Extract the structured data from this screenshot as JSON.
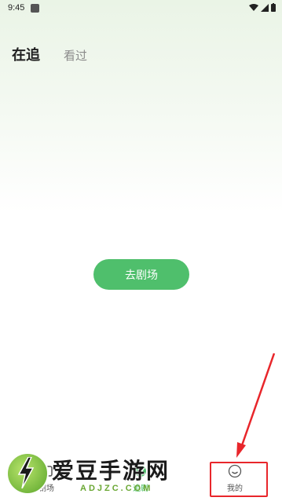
{
  "status_bar": {
    "time": "9:45"
  },
  "header": {
    "tabs": [
      {
        "label": "在追"
      },
      {
        "label": "看过"
      }
    ]
  },
  "main": {
    "go_button_label": "去剧场"
  },
  "bottom_nav": {
    "items": [
      {
        "label": "剧场"
      },
      {
        "label": "追剧"
      },
      {
        "label": "我的"
      }
    ]
  },
  "watermark": {
    "title": "爱豆手游网",
    "domain": "ADJZC.COM"
  },
  "colors": {
    "accent": "#4fbf6c",
    "highlight": "#e8262b"
  }
}
